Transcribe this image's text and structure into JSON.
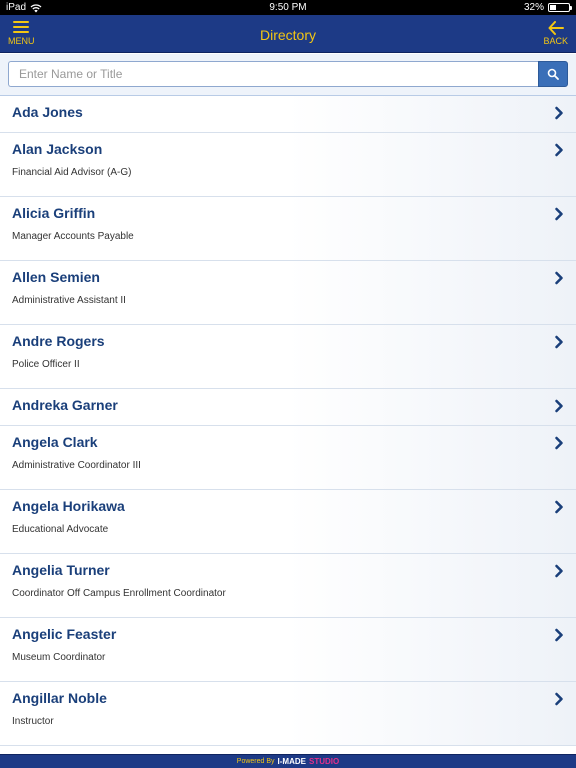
{
  "status_bar": {
    "device": "iPad",
    "time": "9:50 PM",
    "battery": "32%",
    "battery_level": 0.32
  },
  "nav": {
    "title": "Directory",
    "menu_label": "MENU",
    "back_label": "BACK",
    "accent_color": "#f3c613",
    "bar_color": "#1d3a86"
  },
  "search": {
    "placeholder": "Enter Name or Title",
    "value": "",
    "button_icon": "search-icon"
  },
  "directory": [
    {
      "name": "Ada Jones",
      "title": ""
    },
    {
      "name": "Alan Jackson",
      "title": "Financial Aid Advisor (A-G)"
    },
    {
      "name": "Alicia Griffin",
      "title": "Manager Accounts Payable"
    },
    {
      "name": "Allen Semien",
      "title": "Administrative Assistant II"
    },
    {
      "name": "Andre Rogers",
      "title": "Police Officer II"
    },
    {
      "name": "Andreka Garner",
      "title": ""
    },
    {
      "name": "Angela Clark",
      "title": "Administrative Coordinator III"
    },
    {
      "name": "Angela Horikawa",
      "title": "Educational Advocate"
    },
    {
      "name": "Angelia Turner",
      "title": "Coordinator Off Campus Enrollment Coordinator"
    },
    {
      "name": "Angelic Feaster",
      "title": "Museum Coordinator"
    },
    {
      "name": "Angillar Noble",
      "title": "Instructor"
    }
  ],
  "footer": {
    "powered_by": "Powered By",
    "brand_main": "I-MADE",
    "brand_accent": "STUDIO"
  }
}
